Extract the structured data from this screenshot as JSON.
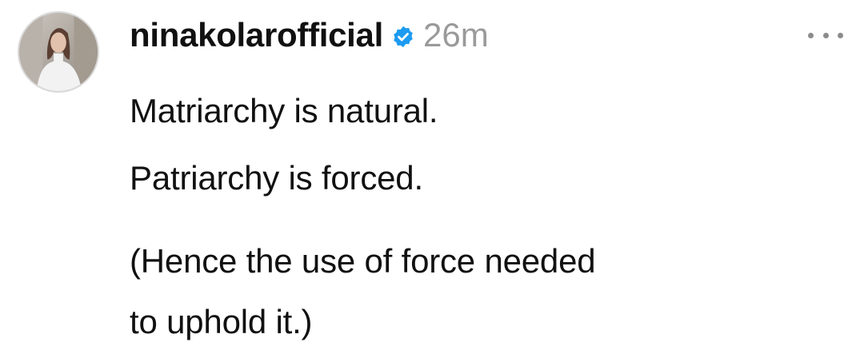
{
  "post": {
    "username": "ninakolarofficial",
    "verified": true,
    "timestamp": "26m",
    "more_icon": "ellipsis-icon",
    "lines": [
      "Matriarchy is natural.",
      "Patriarchy is forced.",
      "(Hence the use of force needed",
      "to uphold it.)"
    ]
  },
  "colors": {
    "verified_badge": "#1d9bf0",
    "timestamp": "#9a9a9a",
    "text": "#111111"
  }
}
